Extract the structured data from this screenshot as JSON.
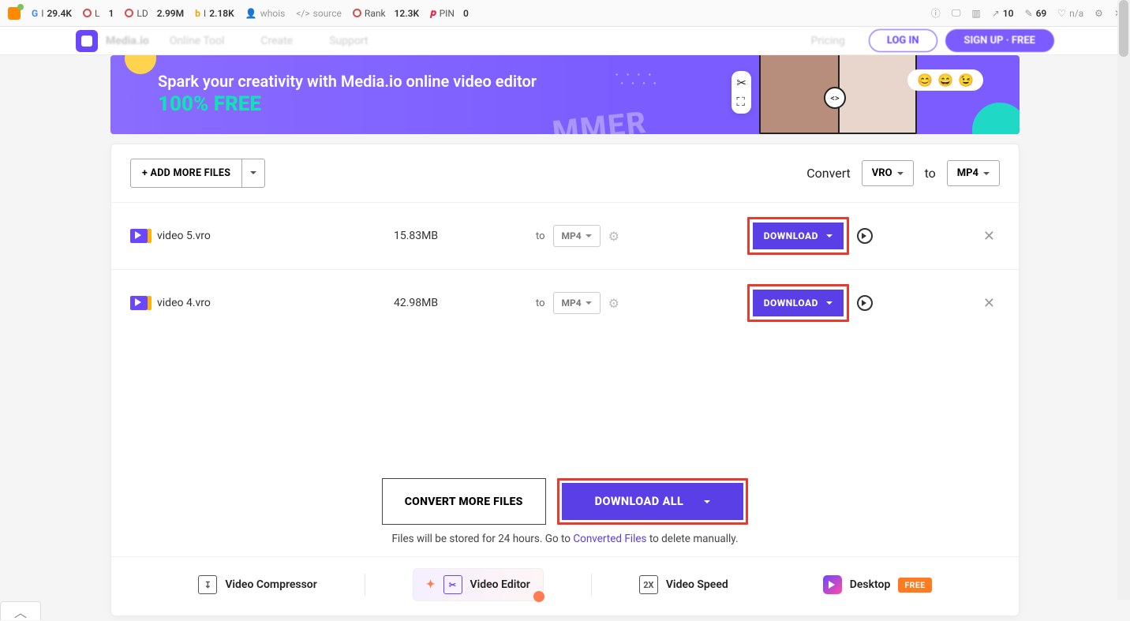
{
  "ext_toolbar": {
    "g_val": "29.4K",
    "l_label": "L",
    "l_val": "1",
    "ld_label": "LD",
    "ld_val": "2.99M",
    "b_val": "2.18K",
    "whois": "whois",
    "source": "source",
    "rank_label": "Rank",
    "rank_val": "12.3K",
    "pin_label": "PIN",
    "pin_val": "0",
    "r1": "10",
    "r2": "69",
    "r3": "n/a"
  },
  "topnav": {
    "brand": "Media.io",
    "m1": "Online Tool",
    "m2": "Create",
    "m3": "Support",
    "m4": "Pricing",
    "login": "LOG IN",
    "signup": "SIGN UP · FREE"
  },
  "banner": {
    "line1": "Spark your creativity with Media.io online video editor",
    "line2": "100% FREE",
    "summer": "MMER"
  },
  "toolbar": {
    "add_label": "+ ADD MORE FILES",
    "convert_label": "Convert",
    "from_fmt": "VRO",
    "to_label": "to",
    "to_fmt": "MP4"
  },
  "files": [
    {
      "name": "video 5.vro",
      "size": "15.83MB",
      "to": "to",
      "fmt": "MP4",
      "dl": "DOWNLOAD"
    },
    {
      "name": "video 4.vro",
      "size": "42.98MB",
      "to": "to",
      "fmt": "MP4",
      "dl": "DOWNLOAD"
    }
  ],
  "actions": {
    "convert_more": "CONVERT MORE FILES",
    "download_all": "DOWNLOAD ALL"
  },
  "note": {
    "pre": "Files will be stored for 24 hours. Go to ",
    "link": "Converted Files",
    "post": " to delete manually."
  },
  "promos": {
    "compressor": "Video Compressor",
    "editor": "Video Editor",
    "speed": "Video Speed",
    "desktop": "Desktop",
    "free": "FREE"
  }
}
